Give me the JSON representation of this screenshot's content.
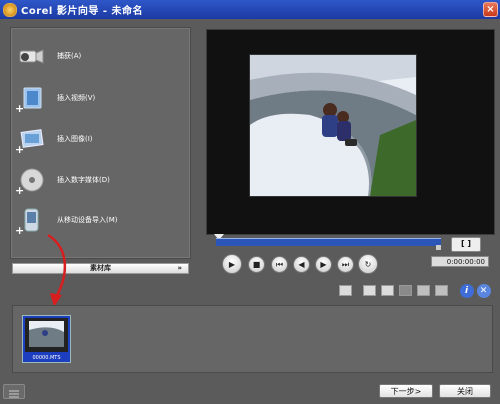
{
  "window": {
    "title": "Corel 影片向导 - 未命名",
    "close_label": "×"
  },
  "left_panel": {
    "items": [
      {
        "label": "捕获(A)",
        "icon": "camcorder-icon"
      },
      {
        "label": "插入视频(V)",
        "icon": "insert-video-icon"
      },
      {
        "label": "插入图像(I)",
        "icon": "insert-image-icon"
      },
      {
        "label": "插入数字媒体(D)",
        "icon": "dvd-disc-icon"
      },
      {
        "label": "从移动设备导入(M)",
        "icon": "mobile-device-icon"
      }
    ],
    "library_label": "素材库",
    "library_chevron": "»"
  },
  "player": {
    "trim_label": "[ ]",
    "timecode": "0:00:00:00",
    "controls": [
      "play",
      "stop",
      "home",
      "previous-frame",
      "next-frame",
      "end",
      "repeat"
    ]
  },
  "library": {
    "thumbnail_caption": "00000.MTS"
  },
  "footer": {
    "next_label": "下一步>",
    "close_label": "关闭"
  },
  "colors": {
    "title_bar": "#2f57c8",
    "panel_bg": "#666666",
    "timeline": "#2b56b8",
    "arrow": "#d81e1e"
  }
}
